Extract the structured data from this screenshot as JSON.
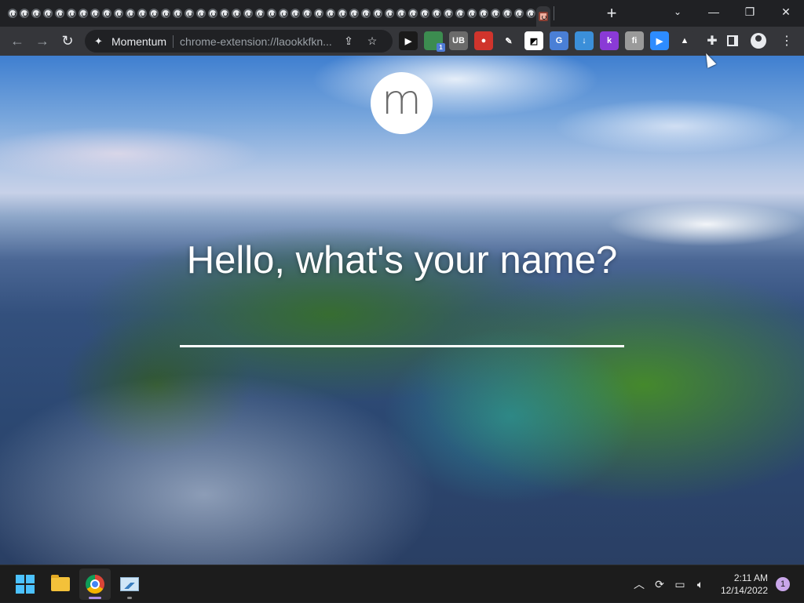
{
  "browser": {
    "tab_count": 46,
    "window_controls": [
      "minimize",
      "restore",
      "close"
    ],
    "omnibox": {
      "site_name": "Momentum",
      "url": "chrome-extension://laookkfkn..."
    },
    "extensions": [
      {
        "name": "cursor-extension",
        "color": "#1a1a1a",
        "glyph": "▶"
      },
      {
        "name": "green-extension",
        "color": "#3c8c50",
        "glyph": "",
        "badge": "1"
      },
      {
        "name": "ublock-extension",
        "color": "#6b6b6b",
        "glyph": "UB"
      },
      {
        "name": "red-extension",
        "color": "#d0342c",
        "glyph": "●"
      },
      {
        "name": "pen-extension",
        "color": "#35363a",
        "glyph": "✎"
      },
      {
        "name": "contrast-extension",
        "color": "#ffffff",
        "glyph": "◩"
      },
      {
        "name": "translate-extension",
        "color": "#4a7fd6",
        "glyph": "G"
      },
      {
        "name": "download-extension",
        "color": "#3b8fd9",
        "glyph": "↓"
      },
      {
        "name": "k-extension",
        "color": "#8a3ad6",
        "glyph": "k"
      },
      {
        "name": "fi-extension",
        "color": "#9a9a9a",
        "glyph": "fi"
      },
      {
        "name": "zoom-extension",
        "color": "#2d8cff",
        "glyph": "▶"
      },
      {
        "name": "drive-extension",
        "color": "#35363a",
        "glyph": "▲"
      }
    ]
  },
  "page": {
    "logo_letter": "m",
    "prompt": "Hello, what's your name?",
    "name_value": ""
  },
  "taskbar": {
    "apps": [
      "start",
      "file-explorer",
      "chrome",
      "monitor-app"
    ],
    "clock_time": "2:11 AM",
    "clock_date": "12/14/2022",
    "notification_count": "1"
  }
}
